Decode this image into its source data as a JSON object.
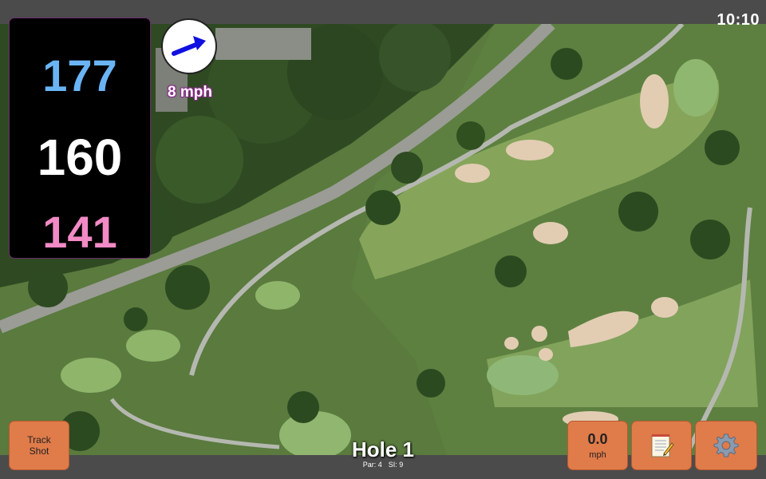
{
  "status_bar": {
    "time": "10:10"
  },
  "distances": {
    "back": "177",
    "middle": "160",
    "front": "141",
    "colors": {
      "back": "#6ab4f5",
      "middle": "#ffffff",
      "front": "#f28ac6"
    }
  },
  "wind": {
    "speed_label": "8 mph",
    "direction_icon": "wind-arrow-icon",
    "arrow_color": "#1010e0"
  },
  "buttons": {
    "track_shot": {
      "line1": "Track",
      "line2": "Shot"
    },
    "speed": {
      "value": "0.0",
      "unit": "mph"
    },
    "notes": {
      "icon": "notepad-icon"
    },
    "settings": {
      "icon": "gear-icon"
    }
  },
  "hole": {
    "title": "Hole 1",
    "par_label": "Par: 4",
    "si_label": "SI: 9"
  },
  "colors": {
    "button_bg": "#e07b4a",
    "panel_bg": "#000000",
    "bar_bg": "#4b4b4b"
  }
}
